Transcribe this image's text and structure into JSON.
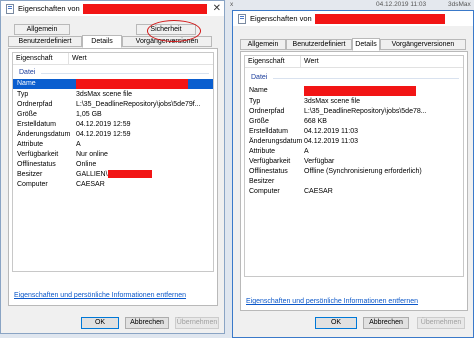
{
  "background": {
    "strip_marker": "x",
    "strip_text_1": "04.12.2019 11:03",
    "strip_text_2": "3dsMax"
  },
  "left_window": {
    "title": "Eigenschaften von",
    "tabs_row1": [
      "Allgemein",
      "Sicherheit"
    ],
    "tabs_row2": [
      "Benutzerdefiniert",
      "Details",
      "Vorgängerversionen"
    ],
    "columns": [
      "Eigenschaft",
      "Wert"
    ],
    "group": "Datei",
    "rows": [
      {
        "key": "Name",
        "value": ""
      },
      {
        "key": "Typ",
        "value": "3dsMax scene file"
      },
      {
        "key": "Ordnerpfad",
        "value": "L:\\35_DeadlineRepository\\jobs\\5de79f..."
      },
      {
        "key": "Größe",
        "value": "1,05 GB"
      },
      {
        "key": "Erstelldatum",
        "value": "04.12.2019 12:59"
      },
      {
        "key": "Änderungsdatum",
        "value": "04.12.2019 12:59"
      },
      {
        "key": "Attribute",
        "value": "A"
      },
      {
        "key": "Verfügbarkeit",
        "value": "Nur online"
      },
      {
        "key": "Offlinestatus",
        "value": "Online"
      },
      {
        "key": "Besitzer",
        "value": "GALLIEN\\"
      },
      {
        "key": "Computer",
        "value": "CAESAR"
      }
    ],
    "link": "Eigenschaften und persönliche Informationen entfernen",
    "buttons": {
      "ok": "OK",
      "cancel": "Abbrechen",
      "apply": "Übernehmen"
    }
  },
  "right_window": {
    "title": "Eigenschaften von",
    "tabs": [
      "Allgemein",
      "Benutzerdefiniert",
      "Details",
      "Vorgängerversionen"
    ],
    "columns": [
      "Eigenschaft",
      "Wert"
    ],
    "group": "Datei",
    "rows": [
      {
        "key": "Name",
        "value": ""
      },
      {
        "key": "Typ",
        "value": "3dsMax scene file"
      },
      {
        "key": "Ordnerpfad",
        "value": "L:\\35_DeadlineRepository\\jobs\\5de78..."
      },
      {
        "key": "Größe",
        "value": "668 KB"
      },
      {
        "key": "Erstelldatum",
        "value": "04.12.2019 11:03"
      },
      {
        "key": "Änderungsdatum",
        "value": "04.12.2019 11:03"
      },
      {
        "key": "Attribute",
        "value": "A"
      },
      {
        "key": "Verfügbarkeit",
        "value": "Verfügbar"
      },
      {
        "key": "Offlinestatus",
        "value": "Offline (Synchronisierung erforderlich)"
      },
      {
        "key": "Besitzer",
        "value": ""
      },
      {
        "key": "Computer",
        "value": "CAESAR"
      }
    ],
    "link": "Eigenschaften und persönliche Informationen entfernen",
    "buttons": {
      "ok": "OK",
      "cancel": "Abbrechen",
      "apply": "Übernehmen"
    }
  },
  "colors": {
    "selection": "#0a5ecf",
    "redaction": "#f21515",
    "annotation": "#d21717",
    "link": "#0b57c9"
  }
}
